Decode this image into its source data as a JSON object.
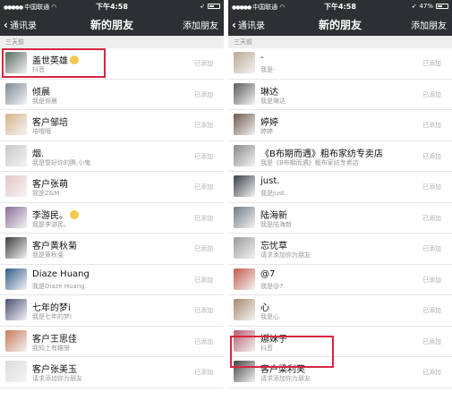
{
  "colors": {
    "header_bg": "#2d2f32",
    "highlight": "#d7263d",
    "section_bg": "#eeeeee"
  },
  "left": {
    "status": {
      "carrier": "中国联通",
      "time": "下午4:58",
      "battery": ""
    },
    "nav": {
      "back": "通讯录",
      "title": "新的朋友",
      "add": "添加朋友"
    },
    "section": "三天前",
    "rows": [
      {
        "name": "盖世英雄",
        "sub": "抖音",
        "state": "已添加",
        "emoji": true,
        "color": "#5a6b5f"
      },
      {
        "name": "倾晨",
        "sub": "我是倾晨",
        "state": "已添加",
        "color": "#7d8a96"
      },
      {
        "name": "客户邹培",
        "sub": "培哦哦",
        "state": "已添加",
        "color": "#d9b38c"
      },
      {
        "name": "烟.",
        "sub": "我是誓好你的腾,小鬼",
        "state": "已添加",
        "color": "#c8c8c8"
      },
      {
        "name": "客户张萌",
        "sub": "我是Z&M",
        "state": "已添加",
        "color": "#e7c6c6"
      },
      {
        "name": "李游民。",
        "sub": "我是李游民。",
        "state": "已添加",
        "emoji": true,
        "color": "#8c6b99"
      },
      {
        "name": "客户黄秋菊",
        "sub": "我是黄秋菊",
        "state": "已添加",
        "color": "#3e3e3e"
      },
      {
        "name": "Diaze Huang",
        "sub": "我是Diaze Huang",
        "state": "已添加",
        "color": "#2f5d8a"
      },
      {
        "name": "七年的梦i",
        "sub": "我是七年的梦i",
        "state": "已添加",
        "color": "#4a4f73"
      },
      {
        "name": "客户王思佳",
        "sub": "我知上有趣誉",
        "state": "已添加",
        "color": "#c97b5a"
      },
      {
        "name": "客户张美玉",
        "sub": "请求添加你为朋友",
        "state": "已添加",
        "color": "#dcdcdc"
      }
    ]
  },
  "right": {
    "status": {
      "carrier": "中国联通",
      "time": "下午4:58",
      "battery": "47%"
    },
    "nav": {
      "back": "通讯录",
      "title": "新的朋友",
      "add": "添加朋友"
    },
    "section": "三天前",
    "rows": [
      {
        "name": "-",
        "sub": "我是-",
        "state": "已添加",
        "color": "#b9a88f"
      },
      {
        "name": "琳达",
        "sub": "我是琳达",
        "state": "已添加",
        "color": "#5d5d5d"
      },
      {
        "name": "婷婷",
        "sub": "婷婷",
        "state": "已添加",
        "color": "#6e5a4c"
      },
      {
        "name": "《B布期而遇》粗布家纺专卖店",
        "sub": "我是《B布期而遇》粗布家纺专卖店",
        "state": "已添加",
        "color": "#8a8a8a"
      },
      {
        "name": "just.",
        "sub": "我是just.",
        "state": "已添加",
        "color": "#3a3f4a"
      },
      {
        "name": "陆海新",
        "sub": "我是陆海新",
        "state": "已添加",
        "color": "#6f7c86"
      },
      {
        "name": "忘忧草",
        "sub": "请求添加你为朋友",
        "state": "已添加",
        "color": "#9a9a9a"
      },
      {
        "name": "@7",
        "sub": "我是@7",
        "state": "已添加",
        "color": "#c45a4a"
      },
      {
        "name": "心",
        "sub": "我是心",
        "state": "已添加",
        "color": "#a88a6e"
      },
      {
        "name": "娜妹子",
        "sub": "抖音",
        "state": "已添加",
        "color": "#b85c6e"
      },
      {
        "name": "客户梁利芙",
        "sub": "请求添加你为朋友",
        "state": "已添加",
        "color": "#444444"
      }
    ]
  }
}
